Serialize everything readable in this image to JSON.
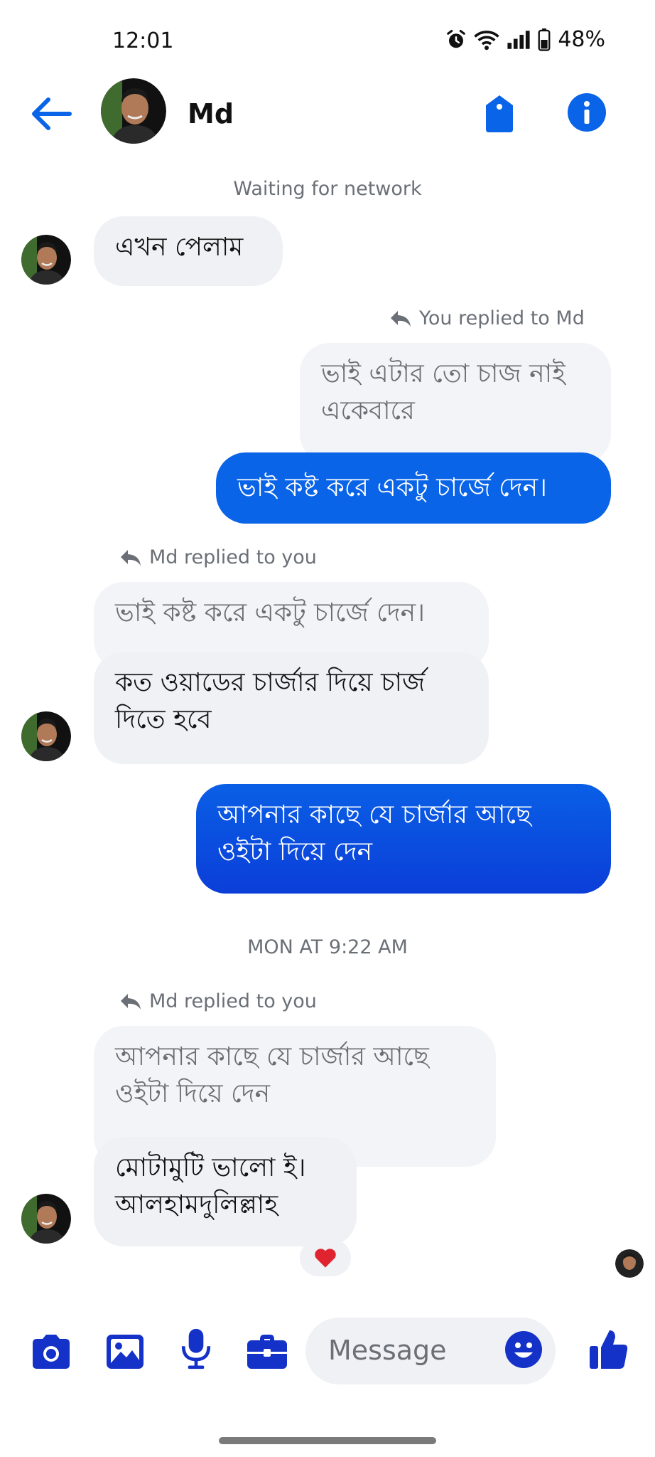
{
  "status_bar": {
    "time": "12:01",
    "battery": "48%"
  },
  "header": {
    "contact_name": "Md",
    "back_icon": "arrow-left-icon",
    "tag_icon": "tag-icon",
    "info_icon": "info-icon"
  },
  "system": {
    "network_notice": "Waiting for network",
    "timestamp": "MON AT 9:22 AM"
  },
  "messages": [
    {
      "from": "contact",
      "text": "এখন পেলাম"
    },
    {
      "reply_label": "You replied to Md",
      "quoted": "ভাই এটার তো চাজ নাই একেবারে",
      "from": "me",
      "text": "ভাই কষ্ট করে একটু চার্জে দেন।"
    },
    {
      "reply_label": "Md replied to you",
      "quoted": "ভাই কষ্ট করে একটু চার্জে দেন।",
      "from": "contact",
      "text": "কত ওয়াডের চার্জার দিয়ে চার্জ দিতে হবে"
    },
    {
      "from": "me",
      "text": "আপনার কাছে যে চার্জার আছে ওইটা দিয়ে দেন"
    },
    {
      "reply_label": "Md replied to you",
      "quoted": "আপনার কাছে যে চার্জার আছে ওইটা দিয়ে দেন",
      "from": "contact",
      "text": "মোটামুটি ভালো ই। আলহামদুলিল্লাহ",
      "reaction": "heart"
    }
  ],
  "composer": {
    "placeholder": "Message",
    "icons": [
      "camera-icon",
      "image-icon",
      "microphone-icon",
      "briefcase-icon",
      "emoji-icon",
      "thumbs-up-icon"
    ]
  },
  "colors": {
    "accent": "#0a64e8",
    "outgoing_top": "#0a64e8",
    "outgoing_bottom": "#0b3fd9",
    "incoming_bg": "#f0f1f5",
    "composer_icon": "#1431c8"
  }
}
